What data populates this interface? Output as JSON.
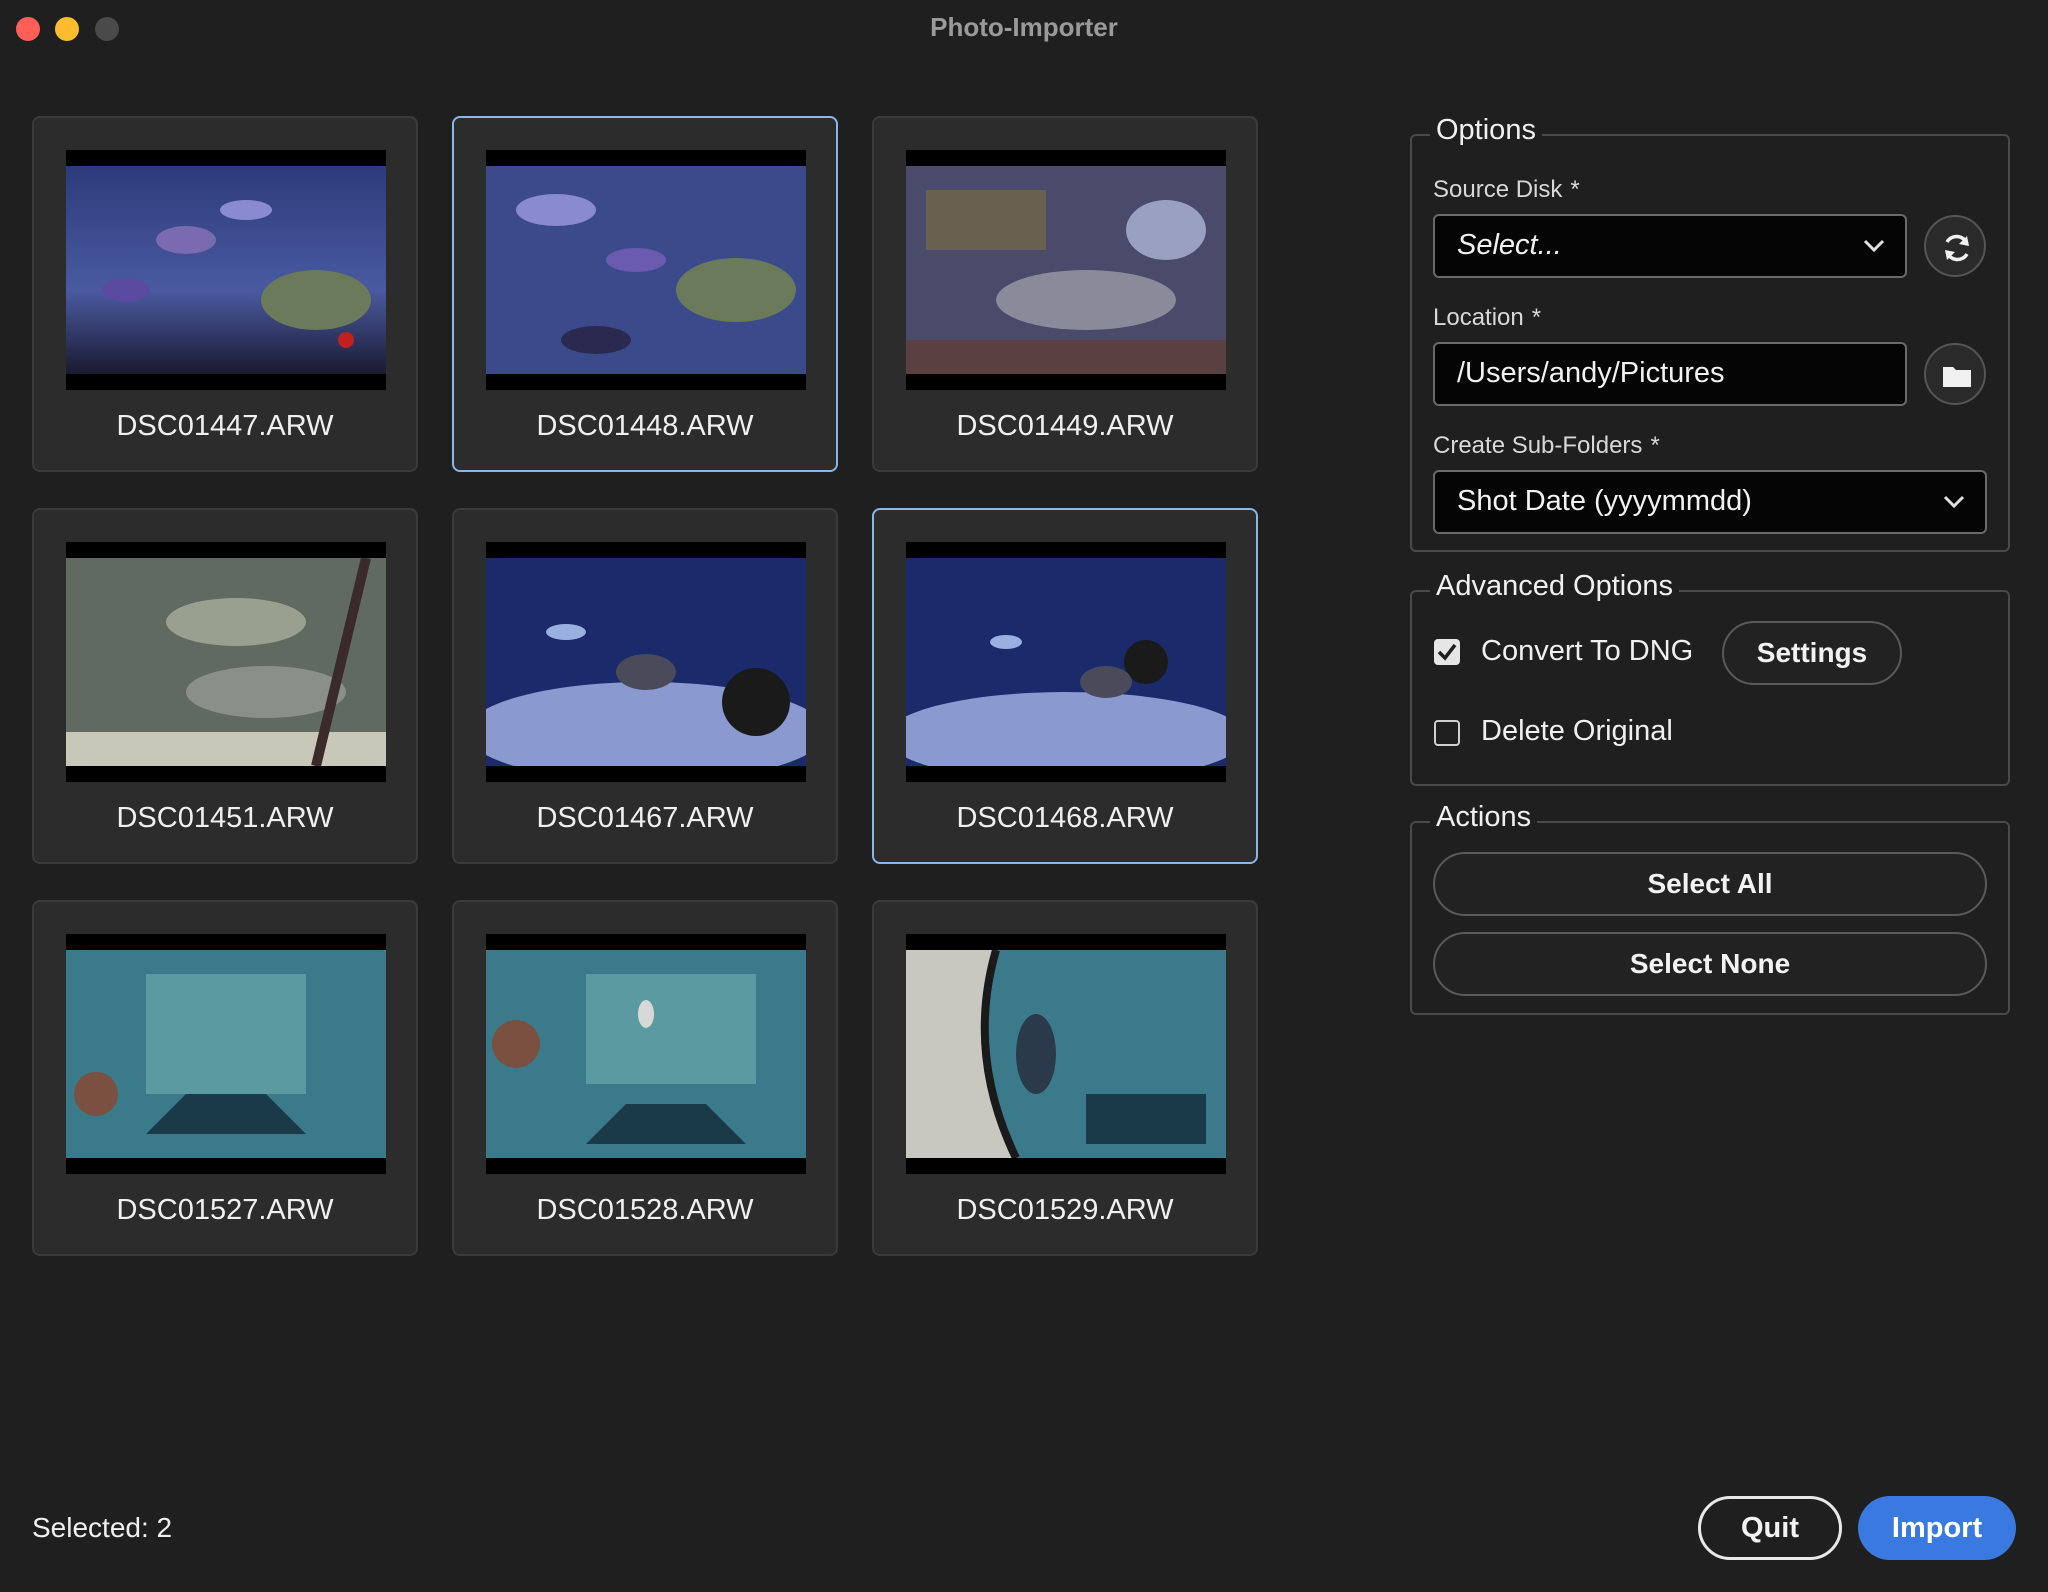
{
  "window": {
    "title": "Photo-Importer"
  },
  "photos": [
    {
      "name": "DSC01447.ARW",
      "selected": false
    },
    {
      "name": "DSC01448.ARW",
      "selected": true
    },
    {
      "name": "DSC01449.ARW",
      "selected": false
    },
    {
      "name": "DSC01451.ARW",
      "selected": false
    },
    {
      "name": "DSC01467.ARW",
      "selected": false
    },
    {
      "name": "DSC01468.ARW",
      "selected": true
    },
    {
      "name": "DSC01527.ARW",
      "selected": false
    },
    {
      "name": "DSC01528.ARW",
      "selected": false
    },
    {
      "name": "DSC01529.ARW",
      "selected": false
    }
  ],
  "options": {
    "legend": "Options",
    "source_disk_label": "Source Disk",
    "source_disk_value": "Select...",
    "location_label": "Location",
    "location_value": "/Users/andy/Pictures",
    "subfolders_label": "Create Sub-Folders",
    "subfolders_value": "Shot Date (yyyymmdd)",
    "required_marker": "*"
  },
  "advanced": {
    "legend": "Advanced Options",
    "convert_label": "Convert To DNG",
    "convert_checked": true,
    "settings_label": "Settings",
    "delete_label": "Delete Original",
    "delete_checked": false
  },
  "actions": {
    "legend": "Actions",
    "select_all": "Select All",
    "select_none": "Select None"
  },
  "footer": {
    "status": "Selected: 2",
    "quit": "Quit",
    "import": "Import"
  },
  "colors": {
    "accent": "#3a7ae0",
    "selection_border": "#8ab6e8"
  }
}
